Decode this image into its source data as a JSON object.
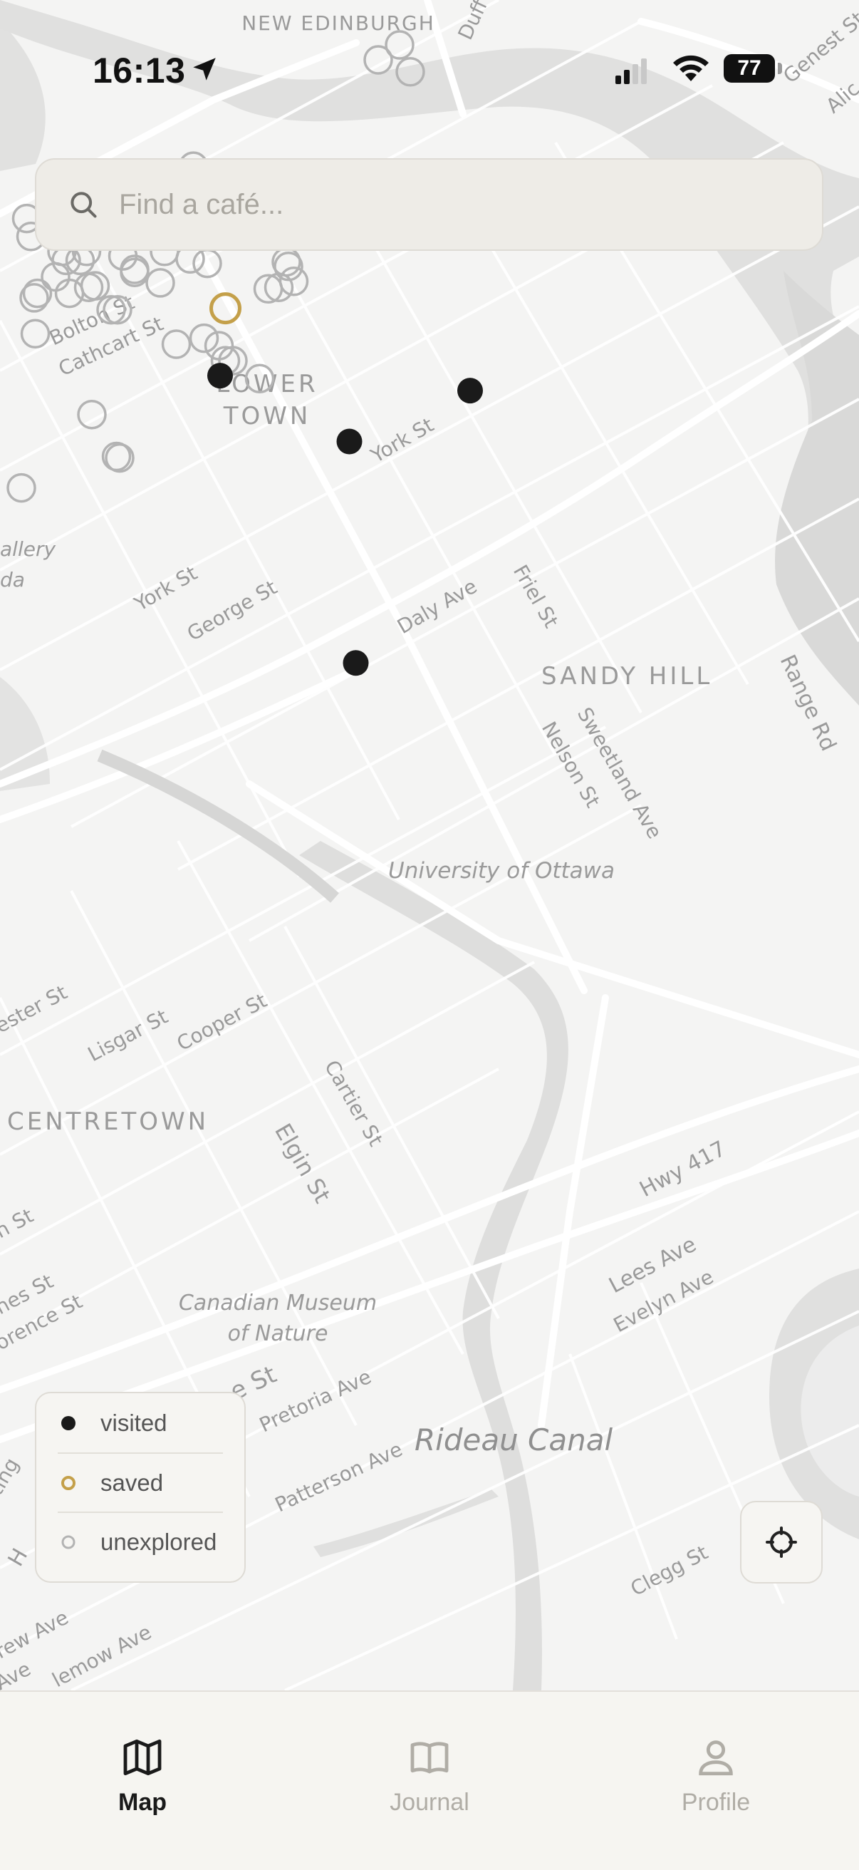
{
  "status_bar": {
    "time": "16:13",
    "battery": "77"
  },
  "search": {
    "placeholder": "Find a café..."
  },
  "map": {
    "labels": {
      "new_edinburgh": "NEW\nEDINBURGH",
      "lower_town": "LOWER\nTOWN",
      "sandy_hill": "SANDY HILL",
      "centretown": "CENTRETOWN",
      "bolton_st": "Bolton St",
      "cathcart_st": "Cathcart St",
      "york_st": "York St",
      "york_st_2": "York St",
      "george_st": "George St",
      "daly_ave": "Daly Ave",
      "friel_st": "Friel St",
      "nelson_st": "Nelson St",
      "sweetland_ave": "Sweetland Ave",
      "range_rd": "Range Rd",
      "university": "University of Ottawa",
      "lisgar_st": "Lisgar St",
      "cooper_st": "Cooper St",
      "cartier_st": "Cartier St",
      "elgin_st": "Elgin St",
      "hwy_417": "Hwy 417",
      "lees_ave": "Lees Ave",
      "evelyn_ave": "Evelyn Ave",
      "museum": "Canadian Museum\nof Nature",
      "pretoria_ave": "Pretoria Ave",
      "patterson_ave": "Patterson Ave",
      "rideau_canal": "Rideau Canal",
      "clegg_st": "Clegg St",
      "gallery": "allery\nda",
      "genest_st": "Genest St",
      "alice": "Alic",
      "dufferin": "Duff",
      "gloucester_st": "ester St",
      "n_st": "n St",
      "nes_st": "nes St",
      "florence_st": "orence St",
      "e_st": "e St",
      "ting": "ting",
      "h": "H",
      "rew_ave": "rew Ave",
      "ave": "Ave",
      "lemow_ave": "lemow Ave"
    },
    "cafes": {
      "visited": [
        {
          "lat": 45.4237,
          "lon": -75.6857
        },
        {
          "lat": 45.4193,
          "lon": -75.6736
        },
        {
          "lat": 45.4227,
          "lon": -75.6623
        },
        {
          "lat": 45.4045,
          "lon": -75.673
        }
      ],
      "saved": [
        {
          "lat": 45.4282,
          "lon": -75.6852
        }
      ],
      "unexplored": [
        {
          "lat": 45.4458,
          "lon": -75.6689
        },
        {
          "lat": 45.4448,
          "lon": -75.6709
        },
        {
          "lat": 45.444,
          "lon": -75.6679
        },
        {
          "lat": 45.4377,
          "lon": -75.6882
        },
        {
          "lat": 45.4366,
          "lon": -75.6862
        },
        {
          "lat": 45.4363,
          "lon": -75.6798
        },
        {
          "lat": 45.4364,
          "lon": -75.6783
        },
        {
          "lat": 45.4341,
          "lon": -75.6837
        },
        {
          "lat": 45.4342,
          "lon": -75.682
        },
        {
          "lat": 45.4371,
          "lon": -75.6985
        },
        {
          "lat": 45.4358,
          "lon": -75.701
        },
        {
          "lat": 45.4353,
          "lon": -75.701
        },
        {
          "lat": 45.4339,
          "lon": -75.6961
        },
        {
          "lat": 45.4342,
          "lon": -75.7038
        },
        {
          "lat": 45.433,
          "lon": -75.7034
        },
        {
          "lat": 45.432,
          "lon": -75.7005
        },
        {
          "lat": 45.4314,
          "lon": -75.7001
        },
        {
          "lat": 45.4314,
          "lon": -75.6988
        },
        {
          "lat": 45.432,
          "lon": -75.6982
        },
        {
          "lat": 45.4317,
          "lon": -75.6948
        },
        {
          "lat": 45.4308,
          "lon": -75.6937
        },
        {
          "lat": 45.4306,
          "lon": -75.6937
        },
        {
          "lat": 45.432,
          "lon": -75.6909
        },
        {
          "lat": 45.4315,
          "lon": -75.6885
        },
        {
          "lat": 45.4312,
          "lon": -75.6869
        },
        {
          "lat": 45.4303,
          "lon": -75.7011
        },
        {
          "lat": 45.4292,
          "lon": -75.6998
        },
        {
          "lat": 45.4296,
          "lon": -75.698
        },
        {
          "lat": 45.4297,
          "lon": -75.6974
        },
        {
          "lat": 45.4299,
          "lon": -75.6913
        },
        {
          "lat": 45.4289,
          "lon": -75.7031
        },
        {
          "lat": 45.4292,
          "lon": -75.7028
        },
        {
          "lat": 45.4281,
          "lon": -75.6959
        },
        {
          "lat": 45.4281,
          "lon": -75.6953
        },
        {
          "lat": 45.4265,
          "lon": -75.703
        },
        {
          "lat": 45.4258,
          "lon": -75.6898
        },
        {
          "lat": 45.4262,
          "lon": -75.6872
        },
        {
          "lat": 45.4257,
          "lon": -75.6858
        },
        {
          "lat": 45.4247,
          "lon": -75.6852
        },
        {
          "lat": 45.4247,
          "lon": -75.6845
        },
        {
          "lat": 45.4235,
          "lon": -75.682
        },
        {
          "lat": 45.431,
          "lon": -75.6793
        },
        {
          "lat": 45.4313,
          "lon": -75.6795
        },
        {
          "lat": 45.43,
          "lon": -75.6788
        },
        {
          "lat": 45.4296,
          "lon": -75.6802
        },
        {
          "lat": 45.4295,
          "lon": -75.6812
        },
        {
          "lat": 45.4211,
          "lon": -75.6977
        },
        {
          "lat": 45.4183,
          "lon": -75.6954
        },
        {
          "lat": 45.4182,
          "lon": -75.6951
        },
        {
          "lat": 45.4162,
          "lon": -75.7043
        }
      ]
    },
    "colors": {
      "visited": "#1a1a1a",
      "saved": "#c4a04a",
      "unexplored": "#b3b3b3"
    }
  },
  "legend": {
    "visited": "visited",
    "saved": "saved",
    "unexplored": "unexplored"
  },
  "tabs": {
    "map": "Map",
    "journal": "Journal",
    "profile": "Profile"
  },
  "icons": {
    "location": "location-arrow-icon",
    "search": "search-icon",
    "recenter": "crosshair-icon",
    "map": "map-icon",
    "journal": "book-open-icon",
    "profile": "person-icon"
  }
}
